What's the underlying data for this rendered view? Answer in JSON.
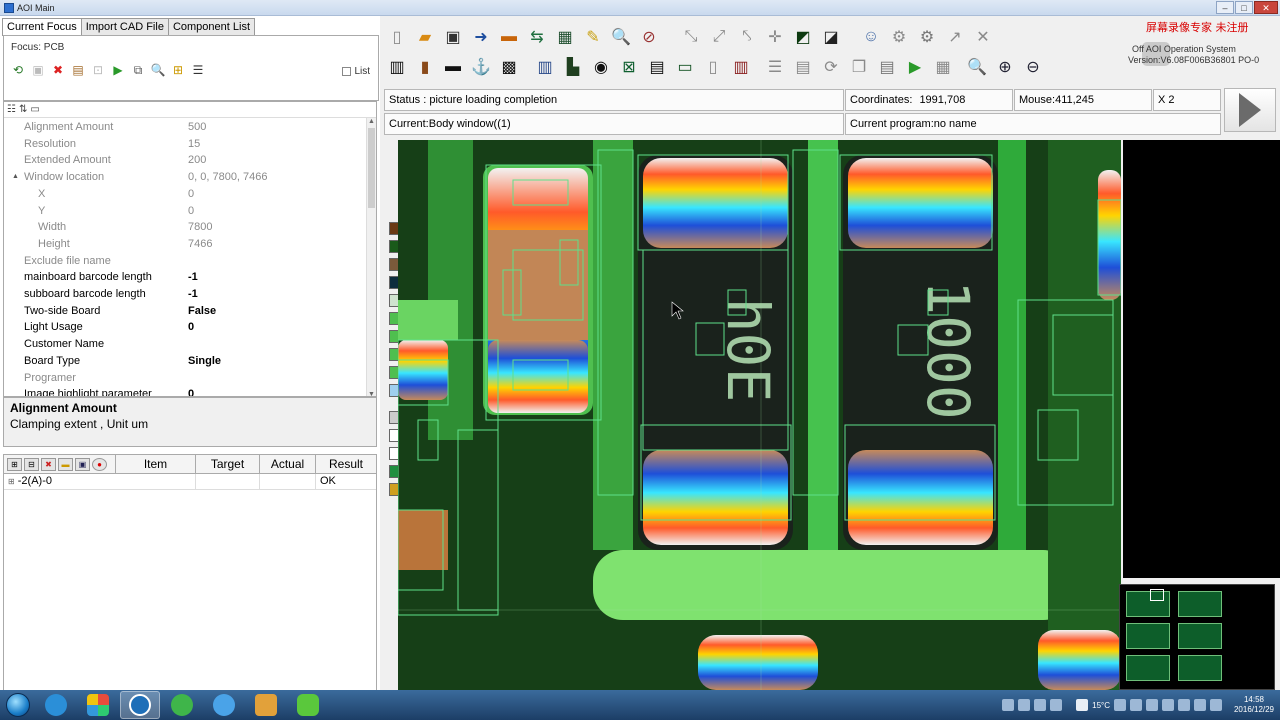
{
  "window": {
    "title": "AOI Main"
  },
  "left_tabs": [
    "Current Focus",
    "Import CAD File",
    "Component List"
  ],
  "focus": {
    "label": "Focus: PCB",
    "list_label": "List"
  },
  "properties": [
    {
      "name": "Alignment Amount",
      "value": "500",
      "dim": true
    },
    {
      "name": "Resolution",
      "value": "15",
      "dim": true
    },
    {
      "name": "Extended Amount",
      "value": "200",
      "dim": true
    },
    {
      "name": "Window location",
      "value": "0, 0, 7800, 7466",
      "dim": true,
      "expander": "▲"
    },
    {
      "name": "X",
      "value": "0",
      "dim": true,
      "sub": true
    },
    {
      "name": "Y",
      "value": "0",
      "dim": true,
      "sub": true
    },
    {
      "name": "Width",
      "value": "7800",
      "dim": true,
      "sub": true
    },
    {
      "name": "Height",
      "value": "7466",
      "dim": true,
      "sub": true
    },
    {
      "name": "Exclude file name",
      "value": "",
      "dim": true
    },
    {
      "name": "mainboard barcode length",
      "value": "-1",
      "bold": true
    },
    {
      "name": "subboard barcode length",
      "value": "-1",
      "bold": true
    },
    {
      "name": "Two-side Board",
      "value": "False",
      "bold": true
    },
    {
      "name": "Light Usage",
      "value": "0",
      "bold": true
    },
    {
      "name": "Customer Name",
      "value": ""
    },
    {
      "name": "Board Type",
      "value": "Single",
      "bold": true
    },
    {
      "name": "Programer",
      "value": "",
      "dim": true
    },
    {
      "name": "Image highlight parameter",
      "value": "0",
      "bold": true
    }
  ],
  "description": {
    "title": "Alignment Amount",
    "text": "Clamping extent , Unit um"
  },
  "results": {
    "columns": [
      "Item",
      "Target",
      "Actual",
      "Result"
    ],
    "rows": [
      {
        "item": "-2(A)-0",
        "target": "",
        "actual": "",
        "result": "OK",
        "expander": "⊞"
      }
    ]
  },
  "status": {
    "status_text": "Status : picture loading completion",
    "coordinates_label": "Coordinates:",
    "coordinates_value": "1991,708",
    "mouse": "Mouse:411,245",
    "zoom": "X 2",
    "current_window": "Current:Body window((1)",
    "current_program": "Current program:no name"
  },
  "brand": {
    "watermark": "屏幕录像专家 未注册",
    "line1": "Off    AOI Operation System",
    "line2": "Version:V6.08F006B36801 PO-0"
  },
  "taskbar": {
    "temperature": "15°C",
    "time": "14:58",
    "date": "2016/12/29"
  },
  "icons": {
    "toolbar1": [
      "new-file-icon",
      "open-folder-icon",
      "save-icon",
      "import-icon",
      "print-icon",
      "undo-icon",
      "grid-icon",
      "wand-icon",
      "zoom-in-icon",
      "zoom-fit-icon",
      "move-disabled-icon",
      "move-disabled-icon",
      "move-disabled-icon",
      "crosshair-disabled-icon",
      "color-block-icon",
      "color-block-icon",
      "user-icon",
      "gear-icon",
      "gear-dark-icon",
      "arrow-disabled-icon",
      "tools-disabled-icon"
    ],
    "toolbar2": [
      "barcode-icon",
      "resistor-icon",
      "chip-icon",
      "anchor-icon",
      "qr-icon",
      "bars-icon",
      "book-icon",
      "target-icon",
      "cross-box-icon",
      "barcode2-icon",
      "frame-icon",
      "clipboard-icon",
      "rack-icon",
      "list-icon",
      "layers-icon",
      "rotate-icon",
      "copy-icon",
      "paste-icon",
      "play-icon",
      "table-icon",
      "zoom-search-icon",
      "zoom-plus-icon",
      "zoom-minus-icon"
    ]
  }
}
